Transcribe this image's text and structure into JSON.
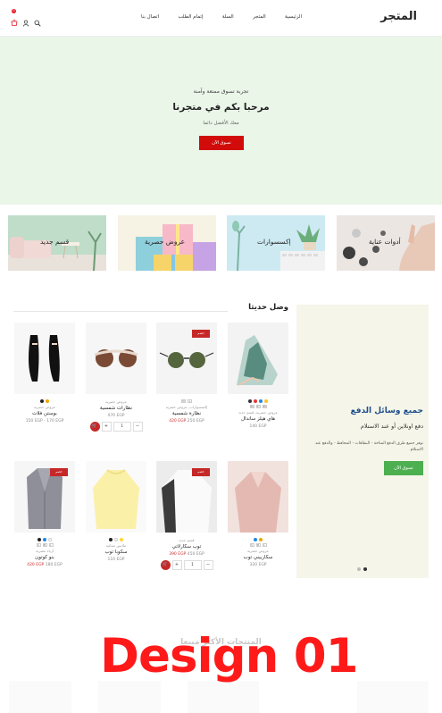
{
  "header": {
    "logo": "المتجر",
    "nav": [
      "الرئيسية",
      "المتجر",
      "السلة",
      "إتمام الطلب",
      "اتصال بنا"
    ],
    "cart_count": "0",
    "icons": [
      "search-icon",
      "user-icon",
      "cart-icon"
    ]
  },
  "hero": {
    "subtitle": "تجربة تسوق ممتعة وآمنة",
    "title": "مرحبا بكم في متجرنا",
    "description": "معك الأفضل دائما",
    "button": "تسوق الآن"
  },
  "categories": [
    {
      "label": "أدوات عناية"
    },
    {
      "label": "إكسسوارات"
    },
    {
      "label": "عروض حصرية"
    },
    {
      "label": "قسم جديد"
    }
  ],
  "new_arrivals": {
    "title": "وصل حديثا"
  },
  "promo": {
    "title": "جميع وسائل الدفع",
    "subtitle": "دفع اونلاين أو عند الاستلام",
    "description": "نوفر جميع طرق الدفع المتاحة - البطاقات - المحافظ - والدفع عند الاستلام",
    "button": "تسوق الآن"
  },
  "products": [
    {
      "category": "عروض حصرية, قسم جديد",
      "name": "هاي هيلز ساندال",
      "price": "140 EGP",
      "sale": "",
      "swatches": [
        "#333333",
        "#e53935",
        "#1e88e5",
        "#fbc02d"
      ],
      "sizes": [
        "36",
        "37",
        "38"
      ],
      "qty": "",
      "sale_badge": ""
    },
    {
      "category": "إكسسوارات, عروض حصرية",
      "name": "نظارة شمسية",
      "price_old": "250 EGP",
      "price_new": "420 EGP",
      "sale_badge": "خصم",
      "qty": "",
      "sizes": [
        "M",
        "L"
      ]
    },
    {
      "category": "عروض حصرية",
      "name": "نظارات شمسية",
      "price": "470 EGP",
      "qty": "1",
      "sale_badge": ""
    },
    {
      "category": "عروض حصرية",
      "name": "بوستن فلات",
      "price": "150 EGP - 170 EGP",
      "swatches": [
        "#222222",
        "#f0a500"
      ],
      "sale_badge": ""
    },
    {
      "category": "عروض حصرية",
      "name": "سكاربيني توب",
      "price": "320 EGP",
      "swatches": [
        "#1e88e5",
        "#f0a500"
      ],
      "sizes": [
        "S",
        "M",
        "L"
      ],
      "sale_badge": ""
    },
    {
      "category": "قسم جديد",
      "name": "توب سكارلاتي",
      "price_old": "450 EGP",
      "price_new": "390 EGP",
      "sale_badge": "خصم",
      "qty": "1"
    },
    {
      "category": "ملابس نسائية",
      "name": "سكوبا توب",
      "price": "110 EGP",
      "swatches": [
        "#222222",
        "#ffffff",
        "#fdd835"
      ],
      "sale_badge": ""
    },
    {
      "category": "أزياء عصرية",
      "name": "بنو كوتون",
      "price_old": "180 EGP",
      "price_new": "420 EGP",
      "sale_badge": "خصم",
      "swatches": [
        "#222222",
        "#1e88e5",
        "#ffffff"
      ],
      "sizes": [
        "S",
        "M",
        "L"
      ]
    }
  ],
  "bottom": {
    "title": "المنتجات الأكثر مبيعا",
    "overlay": "Design 01"
  },
  "colors": {
    "accent_red": "#d10a0a",
    "hero_bg": "#eaf6e8",
    "promo_bg": "#f5f6e9",
    "promo_title": "#1f4e8c",
    "promo_btn": "#4caf50"
  }
}
